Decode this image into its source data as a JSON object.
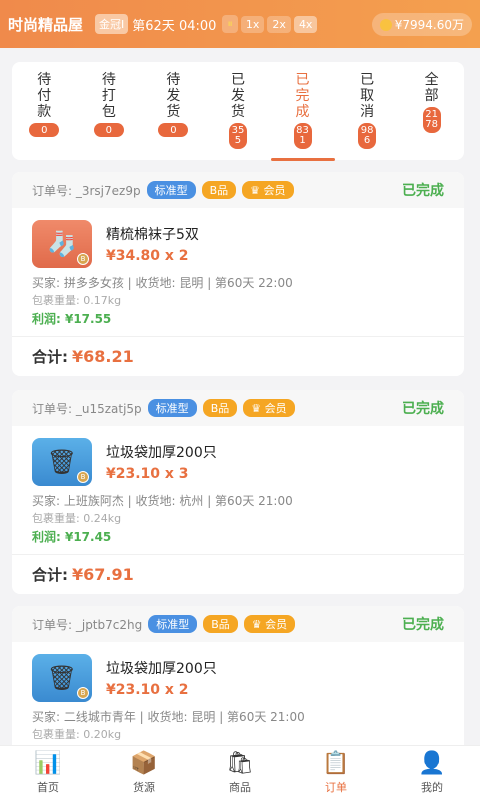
{
  "header": {
    "shop_name": "时尚精品屋",
    "rank_badge": "金冠I",
    "day_time": "第62天 04:00",
    "pause_icon": "⏸",
    "speeds": [
      "1x",
      "2x",
      "4x"
    ],
    "money": "¥7994.60万"
  },
  "tabs": [
    {
      "label": "待付款",
      "count": "0"
    },
    {
      "label": "待打包",
      "count": "0"
    },
    {
      "label": "待发货",
      "count": "0"
    },
    {
      "label": "已发货",
      "count": "355"
    },
    {
      "label": "已完成",
      "count": "831"
    },
    {
      "label": "已取消",
      "count": "986"
    },
    {
      "label": "全部",
      "count": "2178"
    }
  ],
  "orders": [
    {
      "order_no": "订单号: _3rsj7ez9p",
      "tag_type": "标准型",
      "tag_grade": "B品",
      "tag_vip": "会员",
      "status": "已完成",
      "icon": "socks-icon",
      "item_name": "精梳棉袜子5双",
      "item_price": "¥34.80 x 2",
      "buyer": "买家: 拼多多女孩 | 收货地: 昆明 | 第60天 22:00",
      "weight": "包裹重量: 0.17kg",
      "profit": "利润: ¥17.55",
      "total_label": "合计:",
      "total": "¥68.21"
    },
    {
      "order_no": "订单号: _u15zatj5p",
      "tag_type": "标准型",
      "tag_grade": "B品",
      "tag_vip": "会员",
      "status": "已完成",
      "icon": "trash-bag-icon",
      "item_name": "垃圾袋加厚200只",
      "item_price": "¥23.10 x 3",
      "buyer": "买家: 上班族阿杰 | 收货地: 杭州 | 第60天 21:00",
      "weight": "包裹重量: 0.24kg",
      "profit": "利润: ¥17.45",
      "total_label": "合计:",
      "total": "¥67.91"
    },
    {
      "order_no": "订单号: _jptb7c2hg",
      "tag_type": "标准型",
      "tag_grade": "B品",
      "tag_vip": "会员",
      "status": "已完成",
      "icon": "trash-bag-icon",
      "item_name": "垃圾袋加厚200只",
      "item_price": "¥23.10 x 2",
      "buyer": "买家: 二线城市青年 | 收货地: 昆明 | 第60天 21:00",
      "weight": "包裹重量: 0.20kg"
    }
  ],
  "nav": [
    {
      "label": "首页",
      "icon": "chart-icon"
    },
    {
      "label": "货源",
      "icon": "box-icon"
    },
    {
      "label": "商品",
      "icon": "shopping-bag-icon"
    },
    {
      "label": "订单",
      "icon": "clipboard-icon"
    },
    {
      "label": "我的",
      "icon": "user-icon"
    }
  ],
  "colors": {
    "accent": "#e87040",
    "success": "#4caf50",
    "header_start": "#f08a4b",
    "header_end": "#f4a04f"
  }
}
